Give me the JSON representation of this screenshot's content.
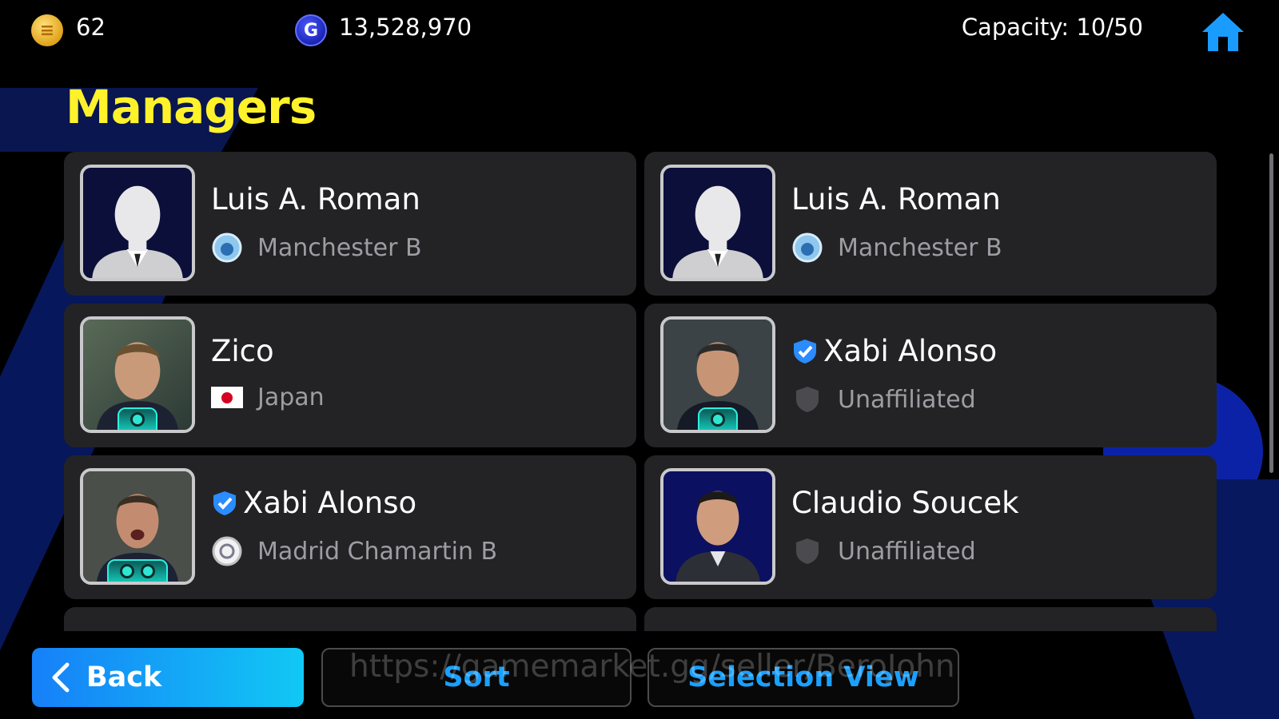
{
  "header": {
    "coins_value": "62",
    "gp_value": "13,528,970",
    "capacity_text": "Capacity: 10/50",
    "icons": [
      "efootball-coin-icon",
      "gp-coin-icon",
      "home-icon"
    ]
  },
  "page_title": "Managers",
  "managers": [
    {
      "name": "Luis A. Roman",
      "affiliation": "Manchester B",
      "affiliation_icon": "club-crest-icon",
      "verified": false,
      "portrait": "silhouette"
    },
    {
      "name": "Luis A. Roman",
      "affiliation": "Manchester B",
      "affiliation_icon": "club-crest-icon",
      "verified": false,
      "portrait": "silhouette"
    },
    {
      "name": "Zico",
      "affiliation": "Japan",
      "affiliation_icon": "japan-flag-icon",
      "verified": false,
      "portrait": "photo"
    },
    {
      "name": "Xabi Alonso",
      "affiliation": "Unaffiliated",
      "affiliation_icon": "shield-icon",
      "verified": true,
      "portrait": "photo"
    },
    {
      "name": "Xabi Alonso",
      "affiliation": "Madrid Chamartin B",
      "affiliation_icon": "club-crest-icon",
      "verified": true,
      "portrait": "photo"
    },
    {
      "name": "Claudio Soucek",
      "affiliation": "Unaffiliated",
      "affiliation_icon": "shield-icon",
      "verified": false,
      "portrait": "photo"
    }
  ],
  "footer": {
    "back_label": "Back",
    "sort_label": "Sort",
    "selection_view_label": "Selection View",
    "watermark": "https://gamemarket.gg/seller/BeroJohn"
  },
  "colors": {
    "title_yellow": "#fff22a",
    "button_blue": "#1aa0ff",
    "card_bg": "#232326"
  }
}
